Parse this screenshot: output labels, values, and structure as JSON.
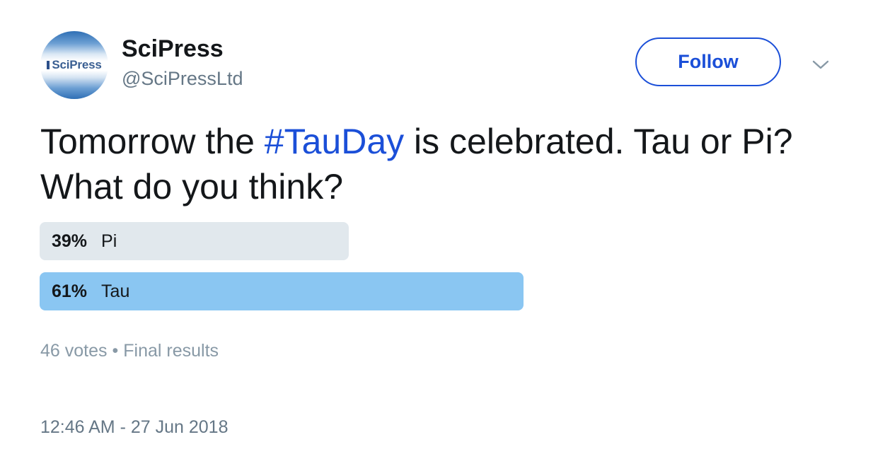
{
  "author": {
    "display_name": "SciPress",
    "handle": "@SciPressLtd",
    "avatar_logo_text": "SciPress"
  },
  "actions": {
    "follow_label": "Follow",
    "more_icon": "chevron-down-icon"
  },
  "tweet": {
    "text_before": "Tomorrow the ",
    "hashtag": "#TauDay",
    "text_after": " is celebrated. Tau or Pi? What do you think?"
  },
  "poll": {
    "options": [
      {
        "percent_label": "39%",
        "label": "Pi",
        "fraction": 0.39,
        "leading": false
      },
      {
        "percent_label": "61%",
        "label": "Tau",
        "fraction": 0.61,
        "leading": true
      }
    ],
    "votes": "46 votes",
    "separator": "•",
    "status": "Final results"
  },
  "timestamp": "12:46 AM - 27 Jun 2018",
  "colors": {
    "link": "#1b4fd8",
    "leading_bar": "#8ac6f2",
    "other_bar": "#e1e8ed",
    "secondary_text": "#657786"
  }
}
